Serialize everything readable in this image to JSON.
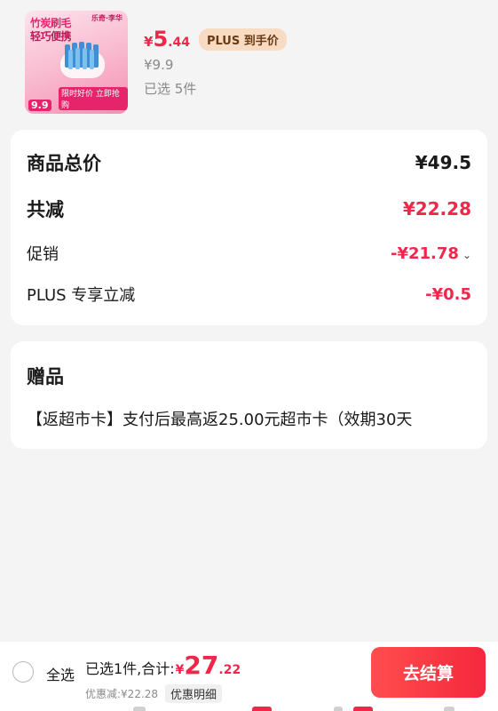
{
  "product": {
    "thumb": {
      "line1": "竹炭刷毛",
      "line2": "轻巧便携",
      "brand": "乐奇·李华",
      "price_tag": "9.9",
      "promo": "限时好价 立即抢购"
    },
    "price_yen": "¥",
    "price_int": "5",
    "price_dec": ".44",
    "plus_badge": "PLUS 到手价",
    "original_price": "¥9.9",
    "selected_qty": "已选 5件"
  },
  "summary": {
    "total_label": "商品总价",
    "total_value": "¥49.5",
    "discount_label": "共减",
    "discount_value": "¥22.28",
    "promo_label": "促销",
    "promo_value": "-¥21.78",
    "plus_label": "PLUS 专享立减",
    "plus_value": "-¥0.5"
  },
  "gift": {
    "title": "赠品",
    "text": "【返超市卡】支付后最高返25.00元超市卡（效期30天"
  },
  "bottom_bar": {
    "select_all": "全选",
    "selected_total": "已选1件,合计:",
    "total_yen": "¥",
    "total_int": "27",
    "total_dec": ".22",
    "discount_text": "优惠减:¥22.28",
    "detail_button": "优惠明细",
    "checkout_button": "去结算"
  },
  "colors": {
    "accent_red": "#f0274a",
    "plus_badge_bg": "#f7dcc3",
    "page_bg": "#f4f4f4"
  }
}
